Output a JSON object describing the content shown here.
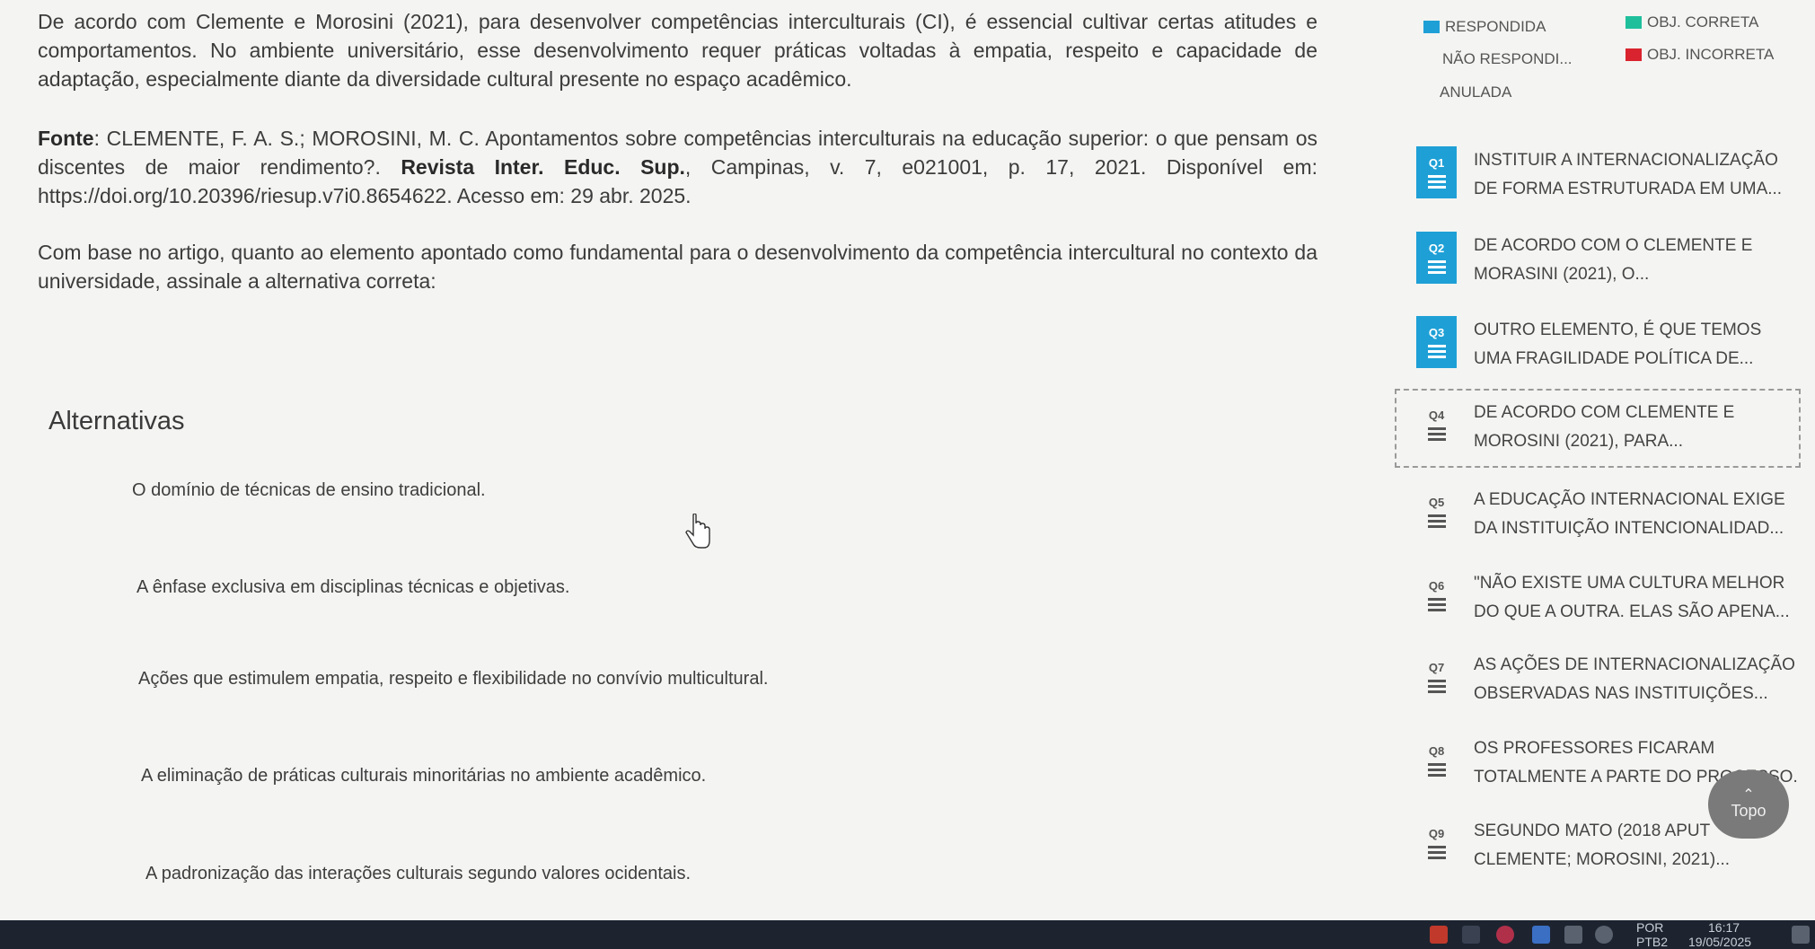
{
  "question": {
    "intro": "De acordo com Clemente e Morosini (2021), para desenvolver competências interculturais (CI), é essencial cultivar certas atitudes e comportamentos. No ambiente universitário, esse desenvolvimento requer práticas voltadas à empatia, respeito e capacidade de adaptação, especialmente diante da diversidade cultural presente no espaço acadêmico.",
    "fonte_label": "Fonte",
    "fonte_authors": ": CLEMENTE, F. A. S.; MOROSINI, M. C. Apontamentos sobre competências interculturais na educação superior: o que pensam os discentes de maior rendimento?. ",
    "fonte_journal": "Revista Inter. Educ. Sup.",
    "fonte_rest": ", Campinas, v. 7, e021001, p. 17, 2021. Disponível em: https://doi.org/10.20396/riesup.v7i0.8654622. Acesso em: 29 abr. 2025.",
    "prompt": "Com base no artigo, quanto ao elemento apontado como fundamental para o desenvolvimento da competência intercultural no contexto da universidade, assinale a alternativa correta:"
  },
  "alternatives": {
    "heading": "Alternativas",
    "items": [
      "O domínio de técnicas de ensino tradicional.",
      "A ênfase exclusiva em disciplinas técnicas e objetivas.",
      "Ações que estimulem empatia, respeito e flexibilidade no convívio multicultural.",
      "A eliminação de práticas culturais minoritárias no ambiente acadêmico.",
      "A padronização das interações culturais segundo valores ocidentais."
    ]
  },
  "legend": {
    "respondida": "RESPONDIDA",
    "nao_respondida": "NÃO RESPONDI...",
    "anulada": "ANULADA",
    "obj_correta": "OBJ. CORRETA",
    "obj_incorreta": "OBJ. INCORRETA",
    "colors": {
      "respondida": "#1ea0d6",
      "correta": "#1fbf9c",
      "incorreta": "#d9232e"
    }
  },
  "questions_nav": [
    {
      "num": "Q1",
      "line1": "INSTITUIR A INTERNACIONALIZAÇÃO",
      "line2": "DE FORMA ESTRUTURADA EM UMA...",
      "answered": true
    },
    {
      "num": "Q2",
      "line1": "DE ACORDO COM O CLEMENTE E",
      "line2": "MORASINI (2021), O...",
      "answered": true
    },
    {
      "num": "Q3",
      "line1": "OUTRO ELEMENTO, É QUE TEMOS",
      "line2": "UMA FRAGILIDADE POLÍTICA DE...",
      "answered": true
    },
    {
      "num": "Q4",
      "line1": "DE ACORDO COM CLEMENTE E",
      "line2": "MOROSINI (2021), PARA...",
      "answered": false
    },
    {
      "num": "Q5",
      "line1": "A EDUCAÇÃO INTERNACIONAL EXIGE",
      "line2": "DA INSTITUIÇÃO INTENCIONALIDAD...",
      "answered": false
    },
    {
      "num": "Q6",
      "line1": "\"NÃO EXISTE UMA CULTURA MELHOR",
      "line2": "DO QUE A OUTRA. ELAS SÃO APENA...",
      "answered": false
    },
    {
      "num": "Q7",
      "line1": "AS AÇÕES DE INTERNACIONALIZAÇÃO",
      "line2": "OBSERVADAS NAS INSTITUIÇÕES...",
      "answered": false
    },
    {
      "num": "Q8",
      "line1": "OS PROFESSORES FICARAM",
      "line2": "TOTALMENTE A PARTE DO PROCESSO...",
      "answered": false
    },
    {
      "num": "Q9",
      "line1": "SEGUNDO MATO (2018 APUT",
      "line2": "CLEMENTE; MOROSINI, 2021)...",
      "answered": false
    }
  ],
  "topo": {
    "label": "Topo"
  },
  "taskbar": {
    "lang1": "POR",
    "lang2": "PTB2",
    "time": "16:17",
    "date": "19/05/2025"
  }
}
